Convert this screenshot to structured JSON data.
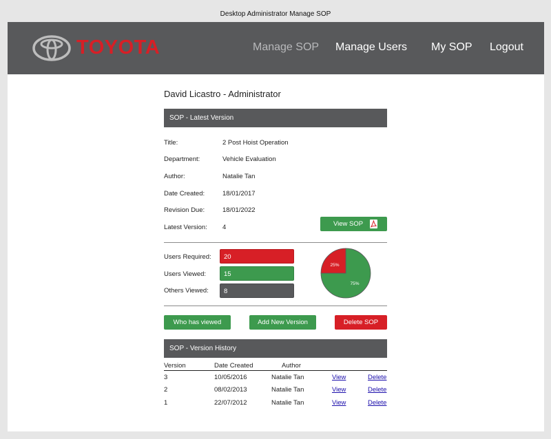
{
  "caption": "Desktop Administrator Manage SOP",
  "brand": {
    "text": "TOYOTA",
    "color": "#d71f26"
  },
  "nav": {
    "manage_sop": "Manage SOP",
    "manage_users": "Manage Users",
    "my_sop": "My SOP",
    "logout": "Logout"
  },
  "page_title": "David Licastro - Administrator",
  "latest": {
    "header": "SOP - Latest Version",
    "fields": [
      {
        "label": "Title:",
        "value": "2 Post Hoist Operation"
      },
      {
        "label": "Department:",
        "value": "Vehicle Evaluation"
      },
      {
        "label": "Author:",
        "value": "Natalie Tan"
      },
      {
        "label": "Date Created:",
        "value": "18/01/2017"
      },
      {
        "label": "Revision Due:",
        "value": "18/01/2022"
      },
      {
        "label": "Latest Version:",
        "value": "4"
      }
    ],
    "view_sop_label": "View SOP"
  },
  "stats": {
    "required": {
      "label": "Users Required:",
      "value": "20"
    },
    "viewed": {
      "label": "Users Viewed:",
      "value": "15"
    },
    "others": {
      "label": "Others Viewed:",
      "value": "8"
    },
    "pie": {
      "red_label": "25%",
      "green_label": "75%",
      "red_fraction": 0.25
    }
  },
  "actions": {
    "who_viewed": "Who has viewed",
    "add_version": "Add New Version",
    "delete_sop": "Delete SOP"
  },
  "history": {
    "header": "SOP - Version History",
    "columns": [
      "Version",
      "Date Created",
      "Author"
    ],
    "rows": [
      {
        "version": "3",
        "date": "10/05/2016",
        "author": "Natalie Tan",
        "view": "View",
        "delete": "Delete"
      },
      {
        "version": "2",
        "date": "08/02/2013",
        "author": "Natalie Tan",
        "view": "View",
        "delete": "Delete"
      },
      {
        "version": "1",
        "date": "22/07/2012",
        "author": "Natalie Tan",
        "view": "View",
        "delete": "Delete"
      }
    ]
  },
  "colors": {
    "green": "#3d9a4e",
    "red": "#d71f26",
    "dark": "#58595b"
  }
}
